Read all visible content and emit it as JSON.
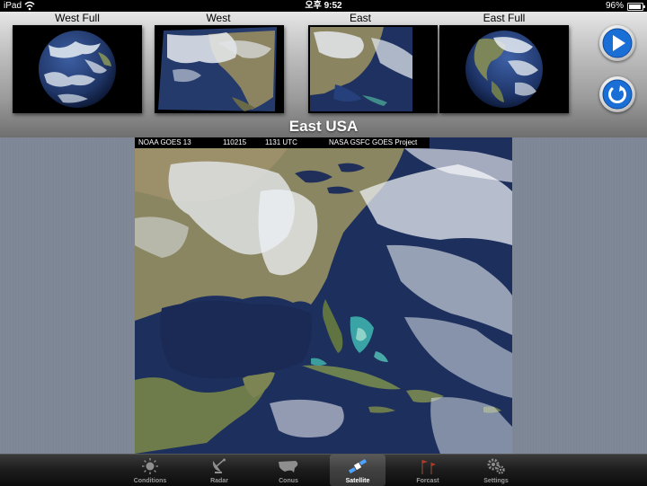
{
  "status_bar": {
    "carrier": "iPad",
    "time": "오후 9:52",
    "battery": "96%",
    "battery_level": 0.96
  },
  "thumbnails": [
    {
      "label": "West Full",
      "icon": "full-disk-earth-image"
    },
    {
      "label": "West",
      "icon": "west-usa-satellite-image"
    },
    {
      "label": "East",
      "icon": "east-usa-satellite-image"
    },
    {
      "label": "East Full",
      "icon": "full-disk-earth-image"
    }
  ],
  "controls": {
    "play_icon": "play-icon",
    "refresh_icon": "refresh-icon",
    "accent": "#1a6fd6"
  },
  "view_title": "East USA",
  "satellite_image": {
    "header_left": "NOAA GOES 13",
    "header_date": "110215",
    "header_time": "1131 UTC",
    "header_right": "NASA GSFC GOES Project"
  },
  "tabbar": {
    "tabs": [
      {
        "label": "Conditions",
        "icon": "sun-icon",
        "active": false
      },
      {
        "label": "Radar",
        "icon": "radar-dish-icon",
        "active": false
      },
      {
        "label": "Conus",
        "icon": "usa-map-icon",
        "active": false
      },
      {
        "label": "Satellite",
        "icon": "satellite-icon",
        "active": true
      },
      {
        "label": "Forcast",
        "icon": "flags-icon",
        "active": false
      },
      {
        "label": "Settings",
        "icon": "gears-icon",
        "active": false
      }
    ]
  }
}
